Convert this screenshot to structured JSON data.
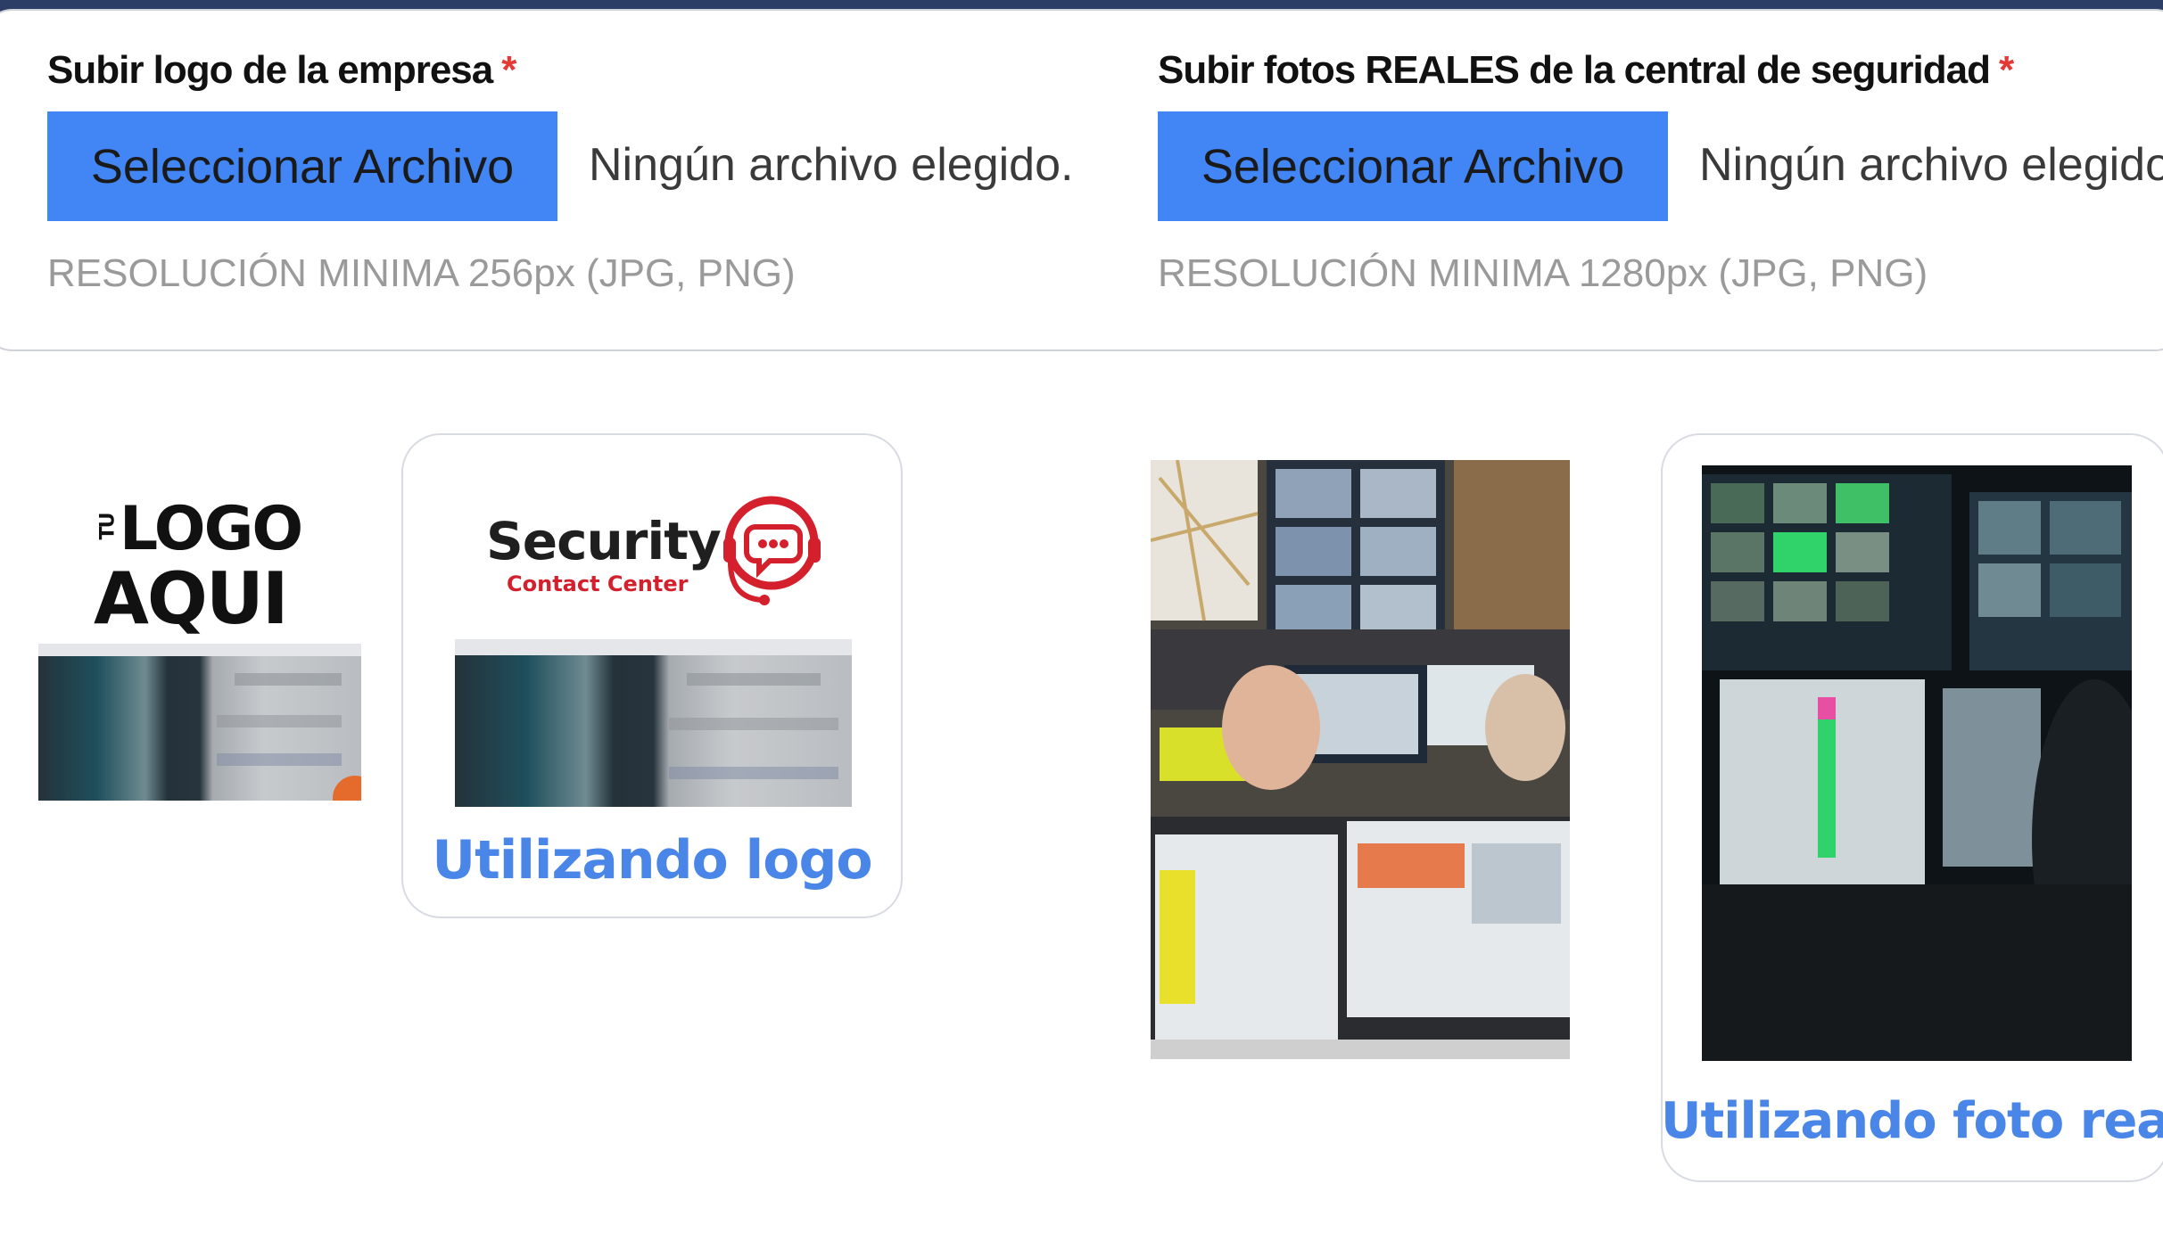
{
  "logo_field": {
    "label": "Subir logo de la empresa",
    "required_mark": "*",
    "button_label": "Seleccionar Archivo",
    "status": "Ningún archivo elegido.",
    "hint": "RESOLUCIÓN MINIMA 256px (JPG, PNG)"
  },
  "photo_field": {
    "label": "Subir fotos REALES de la central de seguridad",
    "required_mark": "*",
    "button_label": "Seleccionar Archivo",
    "status": "Ningún archivo elegido.",
    "hint": "RESOLUCIÓN MINIMA 1280px (JPG, PNG)"
  },
  "logo_placeholder": {
    "top_line": "LOGO",
    "prefix": "TU",
    "bottom_line": "AQUI"
  },
  "logo_example": {
    "brand": "Security",
    "tagline": "Contact Center",
    "caption": "Utilizando logo"
  },
  "photo_example": {
    "caption": "Utilizando foto real"
  },
  "colors": {
    "accent": "#4285f4",
    "caption": "#4a86e8",
    "required": "#e53935",
    "topbar": "#2c3e66",
    "brand_red": "#d4202c"
  }
}
